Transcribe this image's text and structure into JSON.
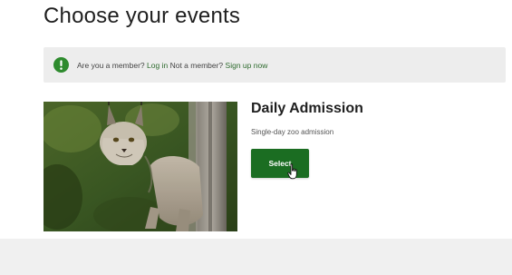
{
  "page": {
    "title": "Choose your events"
  },
  "member_banner": {
    "icon": "exclamation-circle-icon",
    "icon_color": "#2e8b2e",
    "prompt": "Are you a member?",
    "login_link": "Log in",
    "non_member_prompt": "Not a member?",
    "signup_link": "Sign up now"
  },
  "event": {
    "image_subject": "lynx",
    "title": "Daily Admission",
    "description": "Single-day zoo admission",
    "select_label": "Select"
  },
  "colors": {
    "accent": "#1b6d22",
    "link": "#2e6b2e",
    "banner_bg": "#ededed"
  }
}
